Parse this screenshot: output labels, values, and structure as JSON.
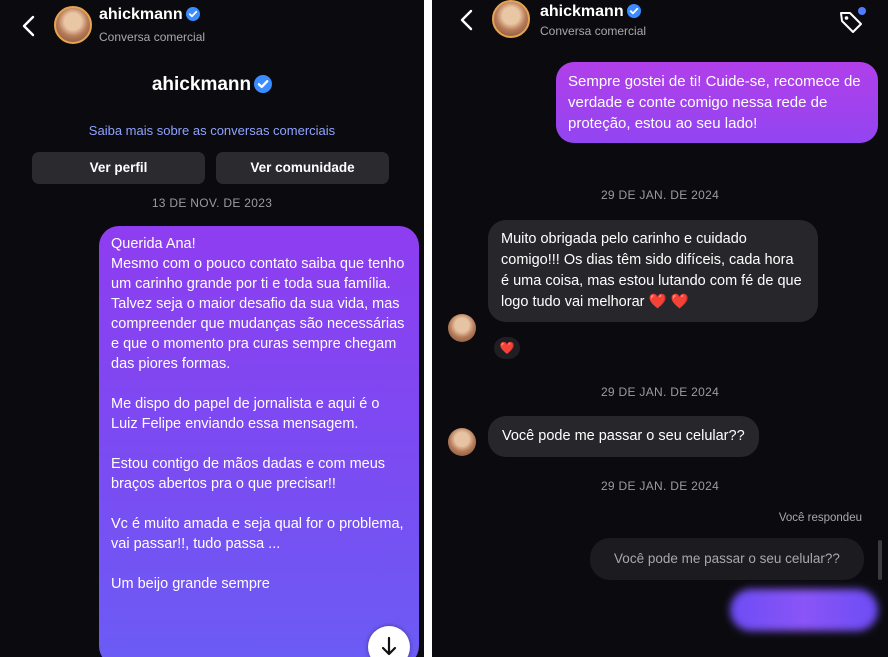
{
  "left": {
    "header": {
      "username": "ahickmann",
      "subtitle": "Conversa comercial"
    },
    "profile_name": "ahickmann",
    "learn_more_link": "Saiba mais sobre as conversas comerciais",
    "buttons": {
      "view_profile": "Ver perfil",
      "view_community": "Ver comunidade"
    },
    "date": "13 DE NOV. DE 2023",
    "message": {
      "paragraphs": [
        "Querida Ana!",
        "Mesmo com o pouco contato saiba que tenho um carinho grande por ti e toda sua família. Talvez seja o maior desafio da sua vida, mas compreender que mudanças são necessárias e que o momento pra curas sempre chegam das piores formas.",
        "Me dispo do papel de jornalista e aqui é o Luiz Felipe enviando essa mensagem.",
        "Estou contigo de mãos dadas e com meus braços abertos pra o que precisar!!",
        "Vc é muito amada e seja qual for o problema, vai passar!!, tudo passa ...",
        "Um beijo grande sempre"
      ]
    }
  },
  "right": {
    "header": {
      "username": "ahickmann",
      "subtitle": "Conversa comercial"
    },
    "messages": {
      "sent_1": "Sempre gostei de ti! Cuide-se, recomece de verdade e conte comigo nessa rede de proteção, estou ao seu lado!",
      "date_1": "29 DE JAN. DE 2024",
      "received_1": "Muito obrigada pelo carinho e cuidado comigo!!! Os dias têm sido difíceis, cada hora é uma coisa, mas estou lutando com fé de que logo tudo vai melhorar",
      "received_1_emoji": "❤️ ❤️",
      "reaction": "❤️",
      "date_2": "29 DE JAN. DE 2024",
      "received_2": "Você pode me passar o seu celular??",
      "date_3": "29 DE JAN. DE 2024",
      "replied_label": "Você respondeu",
      "quoted": "Você pode me passar o seu celular??"
    }
  },
  "colors": {
    "background": "#0b0b0f",
    "bubble_purple": "#8e3df0",
    "bubble_gray": "#26262b",
    "link": "#8ea3ff",
    "verified": "#3a8cff"
  },
  "icons": [
    "back-arrow-icon",
    "verified-badge-icon",
    "tag-icon",
    "arrow-down-icon"
  ]
}
